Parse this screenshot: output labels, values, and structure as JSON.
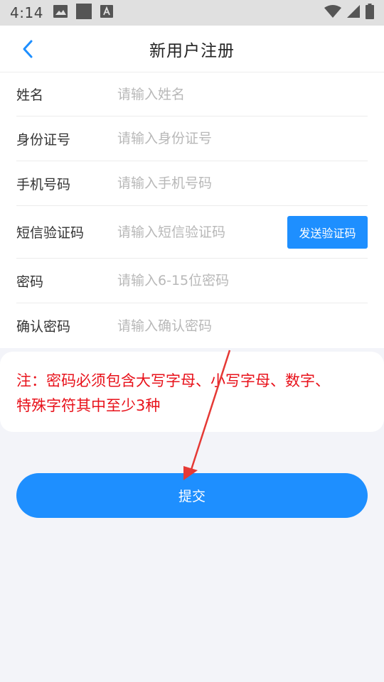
{
  "status_bar": {
    "time": "4:14",
    "left_icons": [
      "image-icon",
      "square-icon",
      "font-icon"
    ],
    "right_icons": [
      "wifi-icon",
      "signal-icon",
      "battery-icon"
    ]
  },
  "header": {
    "title": "新用户注册",
    "back_icon": "chevron-left-icon"
  },
  "form": {
    "name": {
      "label": "姓名",
      "placeholder": "请输入姓名",
      "value": ""
    },
    "id_number": {
      "label": "身份证号",
      "placeholder": "请输入身份证号",
      "value": ""
    },
    "phone": {
      "label": "手机号码",
      "placeholder": "请输入手机号码",
      "value": ""
    },
    "sms_code": {
      "label": "短信验证码",
      "placeholder": "请输入短信验证码",
      "value": "",
      "button_label": "发送验证码"
    },
    "password": {
      "label": "密码",
      "placeholder": "请输入6-15位密码",
      "value": ""
    },
    "confirm_password": {
      "label": "确认密码",
      "placeholder": "请输入确认密码",
      "value": ""
    }
  },
  "note": {
    "line1": "注：密码必须包含大写字母、小写字母、数字、",
    "line2": "特殊字符其中至少3种"
  },
  "submit_label": "提交",
  "colors": {
    "accent": "#1e8fff",
    "note_text": "#e8121b",
    "annotation_arrow": "#e53935",
    "background": "#f3f4f9"
  }
}
